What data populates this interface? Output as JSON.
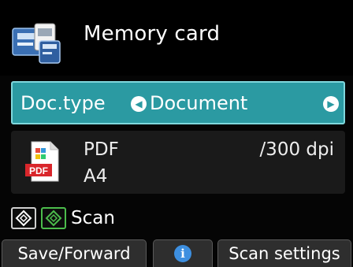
{
  "header": {
    "title": "Memory card",
    "icon": "memory-card-icon"
  },
  "doc_type": {
    "label": "Doc.type",
    "value": "Document",
    "left_arrow": "◀",
    "right_arrow": "▶"
  },
  "settings": {
    "format": "PDF",
    "paper_size": "A4",
    "resolution": "/300 dpi",
    "format_icon_text": "PDF"
  },
  "scan": {
    "label": "Scan",
    "mono_start_icon": "black-start-icon",
    "color_start_icon": "color-start-icon"
  },
  "softkeys": {
    "left_label": "Save/Forward",
    "middle_icon": "i",
    "right_label": "Scan settings"
  },
  "colors": {
    "selector_bg": "#2b9aa2",
    "selector_border": "#7fd7dc",
    "color_start": "#4cbd4c",
    "info_blue": "#3d8fe0"
  }
}
